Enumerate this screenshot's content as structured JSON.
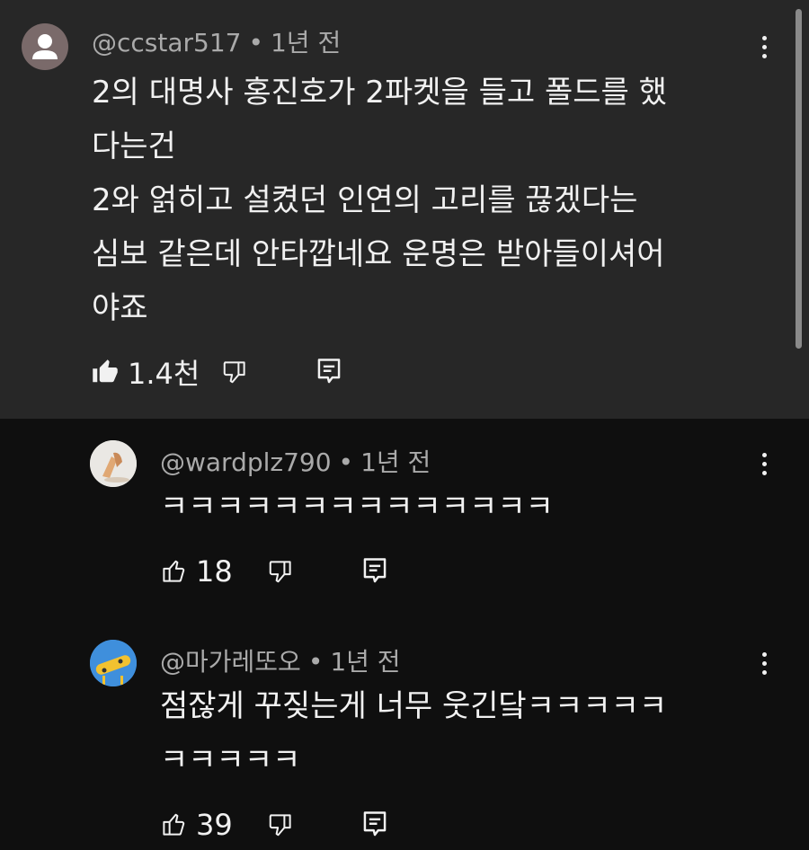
{
  "comments": [
    {
      "author": "@ccstar517",
      "time": "1년 전",
      "text": "2의 대명사 홍진호가 2파켓을 들고 폴드를 했\n다는건\n2와 얽히고 설켰던 인연의 고리를 끊겠다는\n심보 같은데 안타깝네요 운명은 받아들이셔어\n야죠",
      "likes": "1.4천"
    },
    {
      "author": "@wardplz790",
      "time": "1년 전",
      "text": "ㅋㅋㅋㅋㅋㅋㅋㅋㅋㅋㅋㅋㅋㅋ",
      "likes": "18"
    },
    {
      "author": "@마가레또오",
      "time": "1년 전",
      "text": "점잖게 꾸짖는게 너무 웃긴닼ㅋㅋㅋㅋㅋ\nㅋㅋㅋㅋㅋ",
      "likes": "39"
    }
  ],
  "separator": "•",
  "icons": {
    "like_filled": "thumb-up-filled-icon",
    "like": "thumb-up-outline-icon",
    "dislike": "thumb-down-outline-icon",
    "reply": "reply-comment-icon",
    "more": "more-vertical-icon"
  },
  "colors": {
    "page_bg": "#0f0f0f",
    "highlight_bg": "#272727",
    "text_primary": "#f1f1f1",
    "text_secondary": "#aaaaaa"
  }
}
